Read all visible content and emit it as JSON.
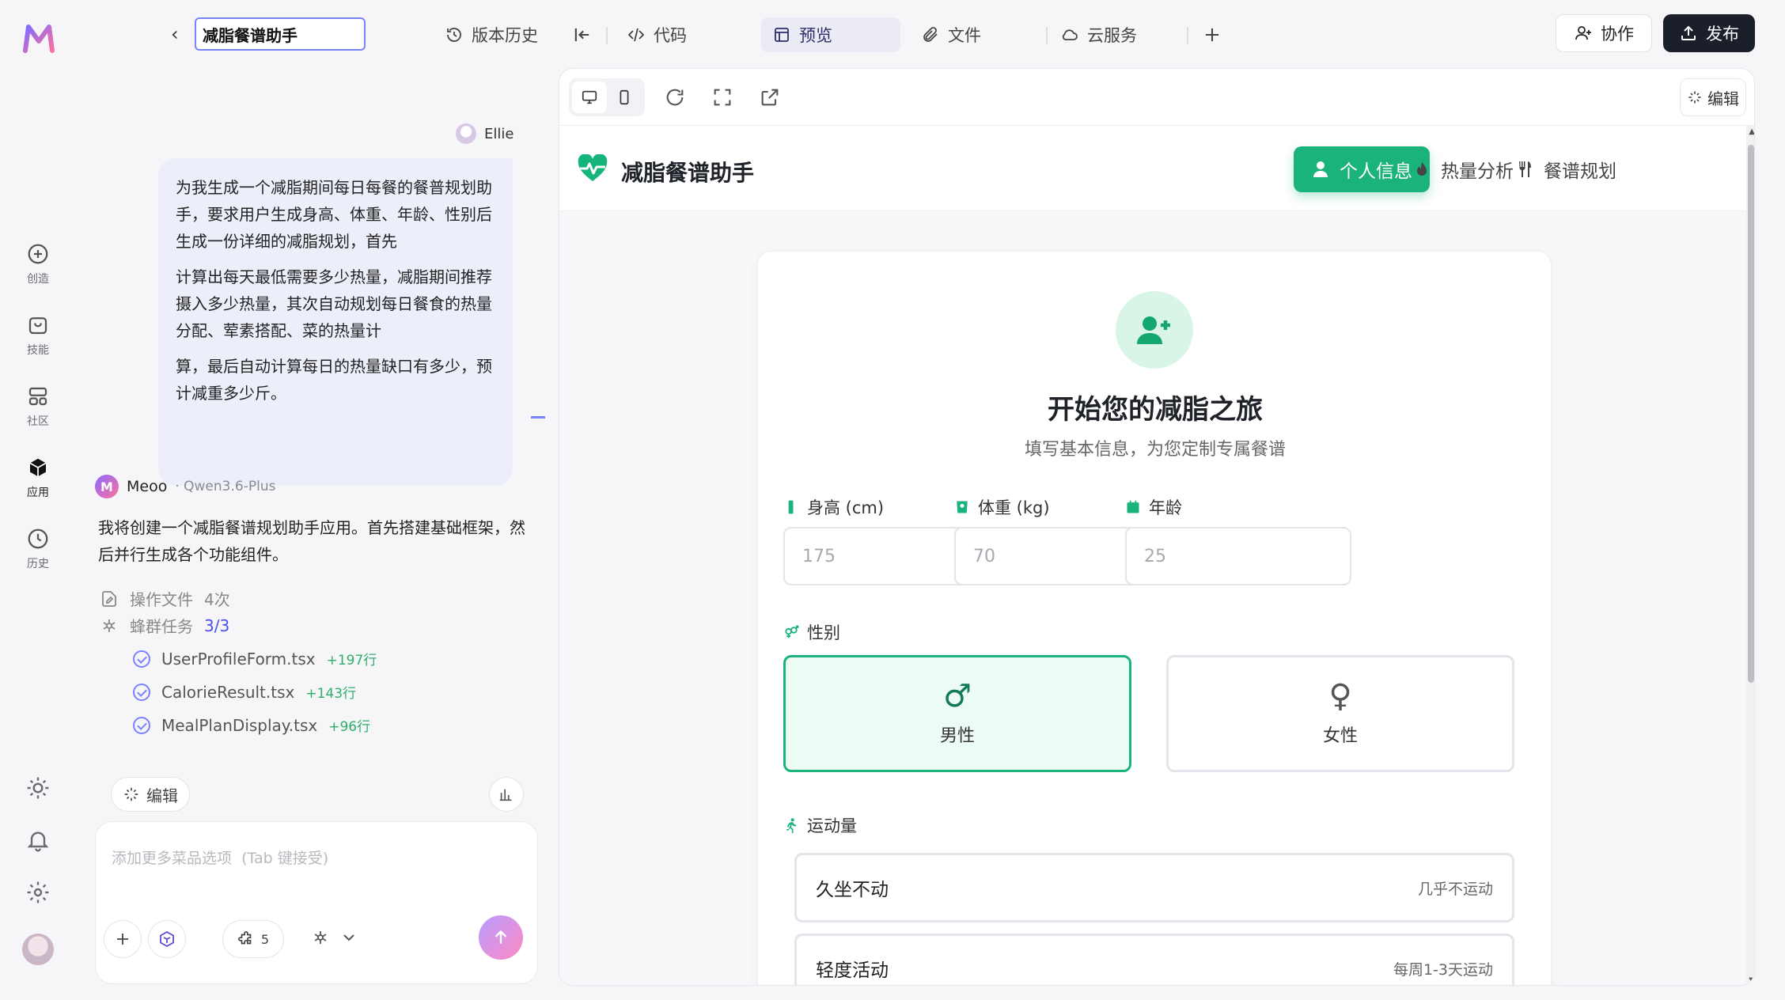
{
  "rail": {
    "items": [
      {
        "label": "创造",
        "icon": "plus-circle-icon"
      },
      {
        "label": "技能",
        "icon": "bag-icon"
      },
      {
        "label": "社区",
        "icon": "grid-icon"
      },
      {
        "label": "应用",
        "icon": "cube-icon"
      },
      {
        "label": "历史",
        "icon": "clock-icon"
      }
    ]
  },
  "topbar": {
    "project_title": "减脂餐谱助手",
    "version_history": "版本历史",
    "code": "代码",
    "preview": "预览",
    "files": "文件",
    "cloud": "云服务",
    "collaborate": "协作",
    "publish": "发布"
  },
  "chat": {
    "user_name": "Ellie",
    "user_message": [
      "为我生成一个减脂期间每日每餐的餐普规划助手，要求用户生成身高、体重、年龄、性别后生成一份详细的减脂规划，首先",
      "计算出每天最低需要多少热量，减脂期间推荐摄入多少热量，其次自动规划每日餐食的热量分配、荤素搭配、菜的热量计",
      "算，最后自动计算每日的热量缺口有多少，预计减重多少斤。"
    ],
    "bot_name": "Meoo",
    "bot_model": "· Qwen3.6-Plus",
    "bot_message": "我将创建一个减脂餐谱规划助手应用。首先搭建基础框架，然后并行生成各个功能组件。",
    "ops_label": "操作文件",
    "ops_count": "4次",
    "swarm_label": "蜂群任务",
    "swarm_count": "3/3",
    "tasks": [
      {
        "file": "UserProfileForm.tsx",
        "added": "+197行"
      },
      {
        "file": "CalorieResult.tsx",
        "added": "+143行"
      },
      {
        "file": "MealPlanDisplay.tsx",
        "added": "+96行"
      }
    ],
    "edit_chip": "编辑",
    "composer_placeholder": "添加更多菜品选项  (Tab 键接受)",
    "skills_count": "5"
  },
  "preview": {
    "edit_label": "编辑",
    "app": {
      "title": "减脂餐谱助手",
      "nav": [
        "个人信息",
        "热量分析",
        "餐谱规划"
      ],
      "hero_title": "开始您的减脂之旅",
      "hero_subtitle": "填写基本信息，为您定制专属餐谱",
      "height_label": "身高 (cm)",
      "height_placeholder": "175",
      "weight_label": "体重 (kg)",
      "weight_placeholder": "70",
      "age_label": "年龄",
      "age_placeholder": "25",
      "gender_label": "性别",
      "male": "男性",
      "female": "女性",
      "activity_label": "运动量",
      "activities": [
        {
          "label": "久坐不动",
          "desc": "几乎不运动"
        },
        {
          "label": "轻度活动",
          "desc": "每周1-3天运动"
        }
      ],
      "accent_color": "#1ab37c"
    }
  }
}
